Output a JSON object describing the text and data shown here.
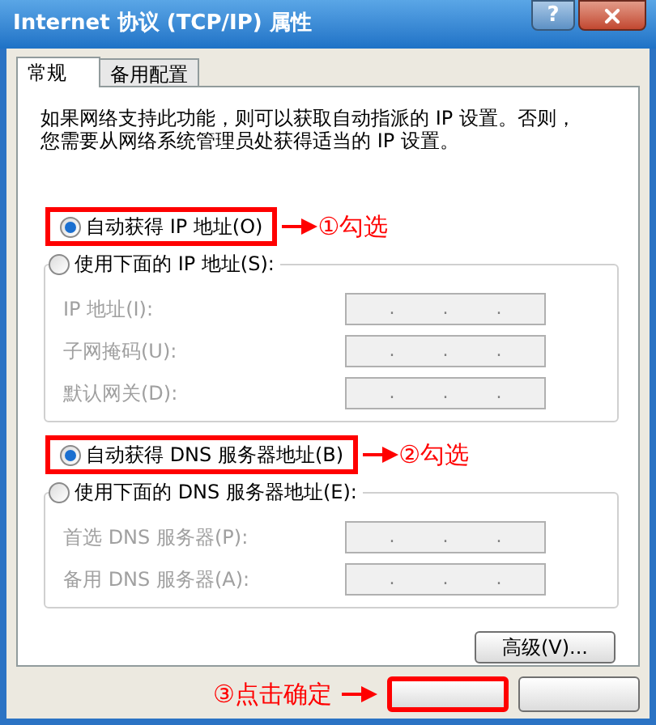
{
  "window": {
    "title": "Internet 协议 (TCP/IP) 属性",
    "help_label": "?"
  },
  "tabs": [
    {
      "label": "常规",
      "selected": true
    },
    {
      "label": "备用配置",
      "selected": false
    }
  ],
  "description": "如果网络支持此功能，则可以获取自动指派的 IP 设置。否则，您需要从网络系统管理员处获得适当的 IP 设置。",
  "sections": [
    {
      "options": [
        {
          "label": "自动获得 IP 地址(O)",
          "selected": true,
          "highlighted": true,
          "annotation": "①勾选"
        },
        {
          "label": "使用下面的 IP 地址(S):",
          "selected": false,
          "highlighted": false
        }
      ],
      "fields": [
        {
          "label": "IP 地址(I):",
          "value": ". . .",
          "disabled": true
        },
        {
          "label": "子网掩码(U):",
          "value": ". . .",
          "disabled": true
        },
        {
          "label": "默认网关(D):",
          "value": ". . .",
          "disabled": true
        }
      ]
    },
    {
      "options": [
        {
          "label": "自动获得 DNS 服务器地址(B)",
          "selected": true,
          "highlighted": true,
          "annotation": "②勾选"
        },
        {
          "label": "使用下面的 DNS 服务器地址(E):",
          "selected": false,
          "highlighted": false
        }
      ],
      "fields": [
        {
          "label": "首选 DNS 服务器(P):",
          "value": ". . .",
          "disabled": true
        },
        {
          "label": "备用 DNS 服务器(A):",
          "value": ". . .",
          "disabled": true
        }
      ]
    }
  ],
  "advanced_button": "高级(V)...",
  "footer": {
    "annotation": "③点击确定",
    "buttons": [
      {
        "highlighted": true
      },
      {
        "highlighted": false
      }
    ]
  }
}
